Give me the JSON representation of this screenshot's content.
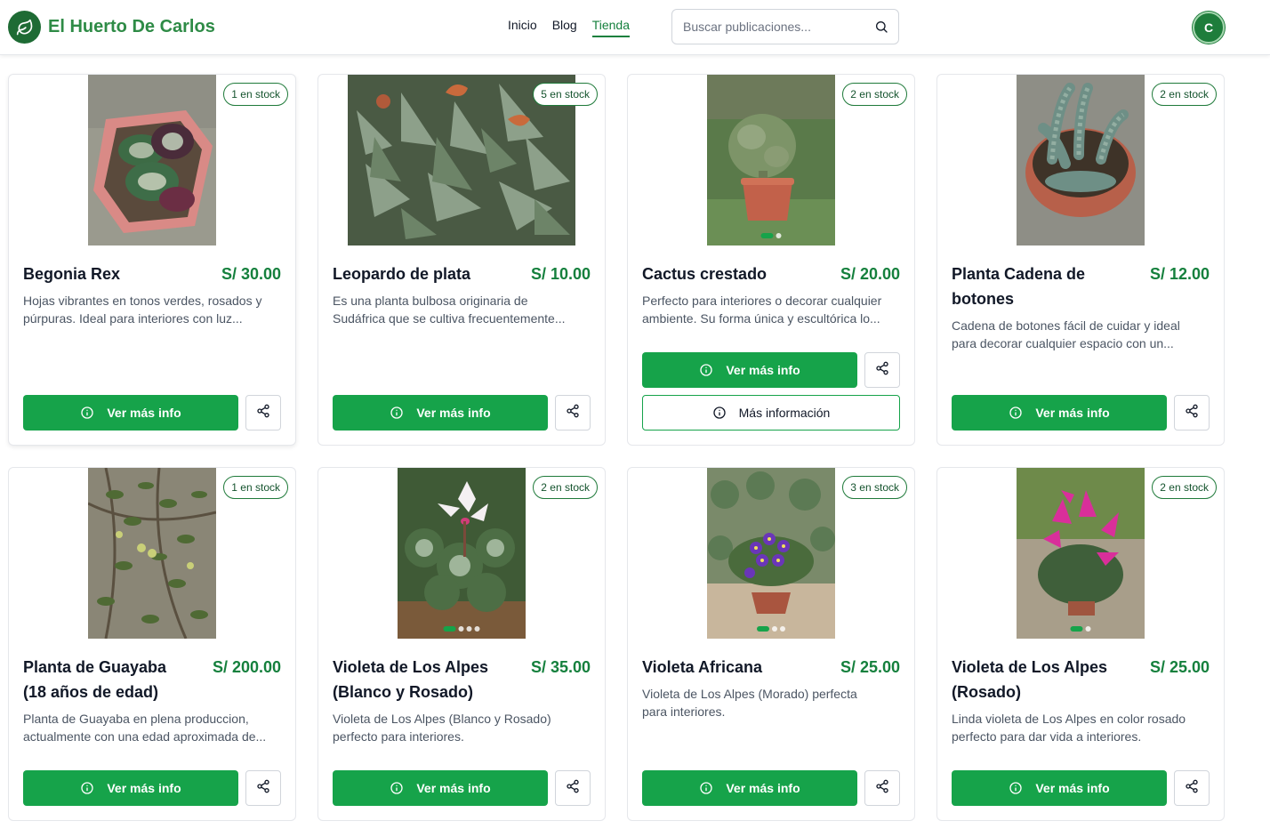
{
  "header": {
    "brand_prefix": "El Huerto ",
    "brand_suffix": "De Carlos",
    "nav": [
      "Inicio",
      "Blog",
      "Tienda"
    ],
    "active_nav": "Tienda",
    "search_placeholder": "Buscar publicaciones...",
    "avatar_initial": "C"
  },
  "products": [
    {
      "name": "Begonia Rex",
      "price": "S/ 30.00",
      "stock": "1 en stock",
      "desc_1": "Hojas vibrantes en tonos verdes, rosados y",
      "desc_2": "púrpuras. Ideal para interiores con luz...",
      "button": "Ver más info"
    },
    {
      "name": "Leopardo de plata",
      "price": "S/ 10.00",
      "stock": "5 en stock",
      "desc_1": "Es una planta bulbosa originaria de",
      "desc_2": "Sudáfrica que se cultiva frecuentemente...",
      "button": "Ver más info"
    },
    {
      "name": "Cactus crestado",
      "price": "S/ 20.00",
      "stock": "2 en stock",
      "desc_1": "Perfecto para interiores o decorar cualquier",
      "desc_2": "ambiente. Su forma única y escultórica lo...",
      "button": "Ver más info",
      "secondary_button": "Más información"
    },
    {
      "name_1": "Planta Cadena de",
      "name_2": "botones",
      "price": "S/ 12.00",
      "stock": "2 en stock",
      "desc_1": "Cadena de botones fácil de cuidar y ideal",
      "desc_2": "para decorar cualquier espacio con un...",
      "button": "Ver más info"
    },
    {
      "name_1": "Planta de Guayaba",
      "name_2": "(18 años de edad)",
      "price": "S/ 200.00",
      "stock": "1 en stock",
      "desc_1": "Planta de Guayaba en plena produccion,",
      "desc_2": "actualmente con una edad aproximada de...",
      "button": "Ver más info"
    },
    {
      "name_1": "Violeta de Los Alpes",
      "name_2": "(Blanco y Rosado)",
      "price": "S/ 35.00",
      "stock": "2 en stock",
      "desc_1": "Violeta de Los Alpes (Blanco y Rosado)",
      "desc_2": "perfecto para interiores.",
      "button": "Ver más info"
    },
    {
      "name": "Violeta Africana",
      "price": "S/ 25.00",
      "stock": "3 en stock",
      "desc_1": "Violeta de Los Alpes (Morado) perfecta",
      "desc_2": "para interiores.",
      "button": "Ver más info"
    },
    {
      "name_1": "Violeta de Los Alpes",
      "name_2": "(Rosado)",
      "price": "S/ 25.00",
      "stock": "2 en stock",
      "desc_1": "Linda violeta de Los Alpes en color rosado",
      "desc_2": "perfecto para dar vida a interiores.",
      "button": "Ver más info"
    }
  ],
  "colors": {
    "accent": "#16a34a",
    "brand": "#2e8b46",
    "price": "#15803d"
  },
  "icons": {
    "logo": "leaf-icon",
    "search": "search-icon",
    "info": "info-icon",
    "share": "share-icon"
  }
}
